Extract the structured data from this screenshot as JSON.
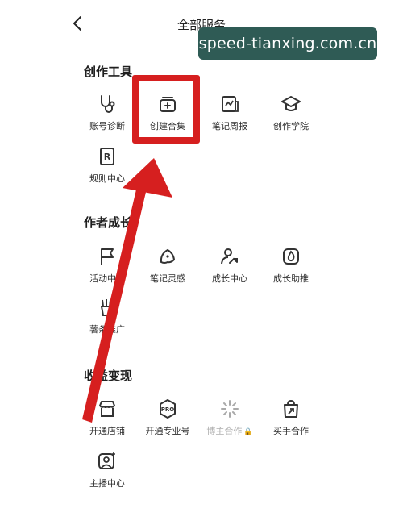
{
  "header": {
    "title": "全部服务",
    "back_icon": "chevron-left-icon"
  },
  "watermark": {
    "text": "speed-tianxing.com.cn",
    "bg": "#2f5b55"
  },
  "sections": [
    {
      "title": "创作工具",
      "items": [
        {
          "label": "账号诊断",
          "icon": "stethoscope-icon"
        },
        {
          "label": "创建合集",
          "icon": "collection-add-icon"
        },
        {
          "label": "笔记周报",
          "icon": "report-icon"
        },
        {
          "label": "创作学院",
          "icon": "graduation-cap-icon"
        },
        {
          "label": "规则中心",
          "icon": "rules-book-icon"
        }
      ]
    },
    {
      "title": "作者成长",
      "items": [
        {
          "label": "活动中心",
          "icon": "flag-icon"
        },
        {
          "label": "笔记灵感",
          "icon": "inspiration-icon"
        },
        {
          "label": "成长中心",
          "icon": "user-growth-icon"
        },
        {
          "label": "成长助推",
          "icon": "flame-icon"
        },
        {
          "label": "薯条推广",
          "icon": "fries-icon"
        }
      ]
    },
    {
      "title": "收益变现",
      "items": [
        {
          "label": "开通店铺",
          "icon": "shop-icon"
        },
        {
          "label": "开通专业号",
          "icon": "pro-badge-icon"
        },
        {
          "label": "博主合作",
          "icon": "sparkle-icon",
          "locked": true
        },
        {
          "label": "买手合作",
          "icon": "shopping-bag-icon"
        },
        {
          "label": "主播中心",
          "icon": "host-portrait-icon"
        }
      ]
    }
  ],
  "colors": {
    "annotation_red": "#d61f1f"
  }
}
